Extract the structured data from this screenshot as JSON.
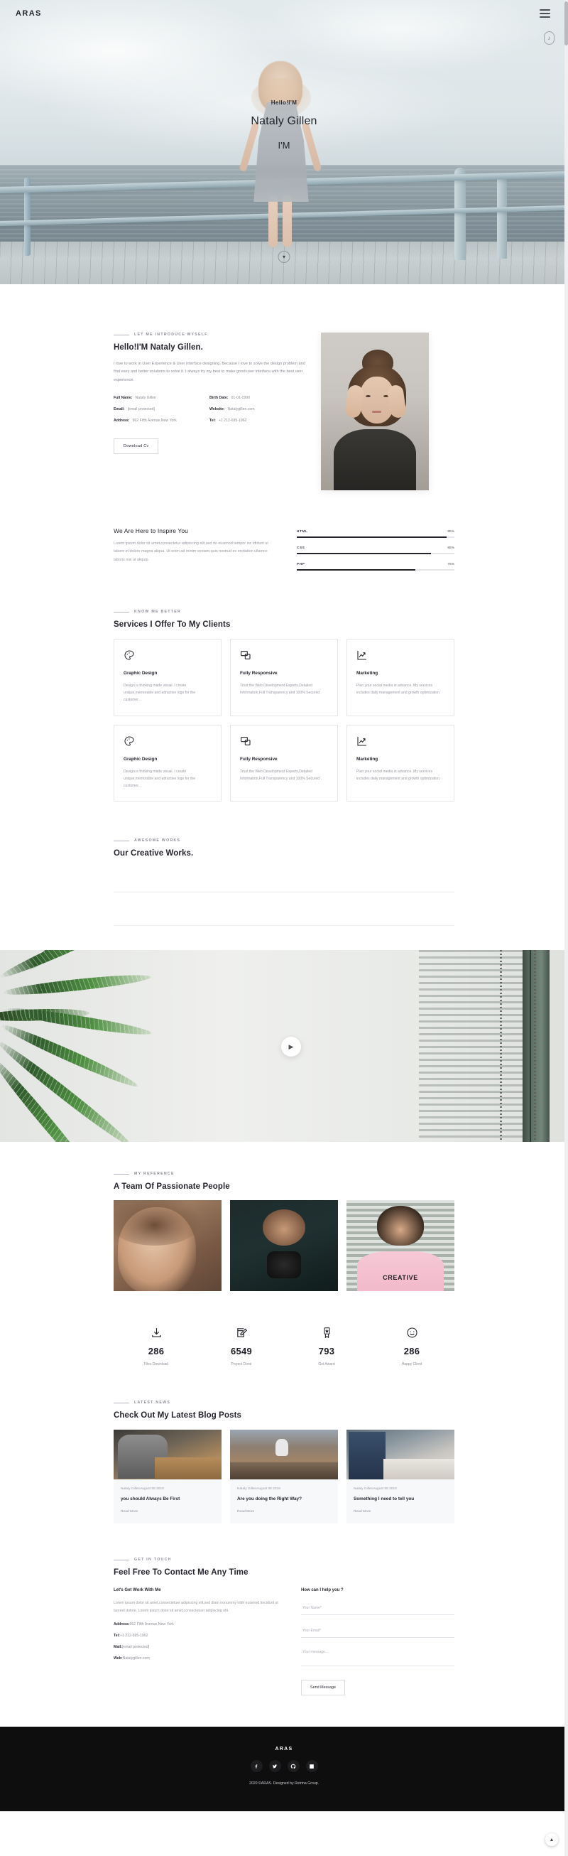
{
  "header": {
    "brand": "ARAS",
    "menu_icon": "hamburger-icon",
    "sound_icon": "sound-toggle-icon"
  },
  "hero": {
    "greeting": "Hello!I'M",
    "name": "Nataly Gillen",
    "role": "I'M",
    "scroll_icon": "chevron-down-icon"
  },
  "about": {
    "eyebrow": "LET ME INTRODUCE MYSELF.",
    "title": "Hello!I'M Nataly Gillen.",
    "paragraph": "I love to work in User Experience & User Interface designing. Because I love to solve the design problem and find easy and better solutions to solve it. I always try my best to make good user interface with the best user experience.",
    "info": [
      {
        "key": "Full Name:",
        "value": "Nataly Gillen"
      },
      {
        "key": "Birth Date:",
        "value": "01-01-1990"
      },
      {
        "key": "Email:",
        "value": "[email protected]"
      },
      {
        "key": "Website:",
        "value": "Natalygillen.com"
      },
      {
        "key": "Address:",
        "value": "962 Fifth Avenue,New York"
      },
      {
        "key": "Tel:",
        "value": "+1 212-695-1962"
      }
    ],
    "cta": "Download Cv"
  },
  "skills": {
    "title": "We Are Here to Inspire You",
    "paragraph": "Lorem ipsum dolor sit amet,consectetur adipiscing elit,sed do eiusmod tempor inc ididunt ut labore et dolore magna aliqua. Ut enim ad minim veniam,quis nostrud ex ercitation ullamco laboris nisi ut aliquip.",
    "bars": [
      {
        "name": "HTML",
        "pct": "95%",
        "value": 95
      },
      {
        "name": "CSS",
        "pct": "85%",
        "value": 85
      },
      {
        "name": "PHP",
        "pct": "75%",
        "value": 75
      }
    ]
  },
  "services": {
    "eyebrow": "KNOW ME BETTER",
    "title": "Services I Offer To My Clients",
    "cards": [
      {
        "icon": "palette-icon",
        "title": "Graphic Design",
        "desc": "Design is thinking made visual. I create unique,memorable and attractive logo for the customer. ."
      },
      {
        "icon": "responsive-icon",
        "title": "Fully Responsive",
        "desc": "Trust the Web Development Experts,Detailed Information,Full Transparency and 100% Secured ."
      },
      {
        "icon": "chart-growth-icon",
        "title": "Marketing",
        "desc": "Plan your social media in advance. My services includes daily management and growth optimization."
      },
      {
        "icon": "palette-icon",
        "title": "Graphic Design",
        "desc": "Design is thinking made visual. I create unique,memorable and attractive logo for the customer. ."
      },
      {
        "icon": "responsive-icon",
        "title": "Fully Responsive",
        "desc": "Trust the Web Development Experts,Detailed Information,Full Transparency and 100% Secured ."
      },
      {
        "icon": "chart-growth-icon",
        "title": "Marketing",
        "desc": "Plan your social media in advance. My services includes daily management and growth optimization."
      }
    ]
  },
  "works": {
    "eyebrow": "AWESOME WORKS",
    "title": "Our Creative Works."
  },
  "parallax": {
    "play_icon": "play-icon"
  },
  "team": {
    "eyebrow": "MY REFERENCE",
    "title": "A Team Of Passionate People",
    "members": [
      {
        "photo": "woman-portrait"
      },
      {
        "photo": "photographer-portrait"
      },
      {
        "photo": "man-creative-tshirt",
        "shirt_text": "CREATIVE"
      }
    ]
  },
  "counters": [
    {
      "icon": "download-icon",
      "num": "286",
      "label": "Files Download"
    },
    {
      "icon": "edit-square-icon",
      "num": "6549",
      "label": "Project Done"
    },
    {
      "icon": "award-ribbon-icon",
      "num": "793",
      "label": "Get Award"
    },
    {
      "icon": "smiley-icon",
      "num": "286",
      "label": "Happy Client"
    }
  ],
  "blog": {
    "eyebrow": "LATEST NEWS",
    "title": "Check Out My Latest Blog Posts",
    "posts": [
      {
        "meta": "Nataly GillenAugust 06 2019",
        "title": "you should Always Be First",
        "more": "Read More"
      },
      {
        "meta": "Nataly GillenAugust 06 2019",
        "title": "Are you doing the Right Way?",
        "more": "Read More"
      },
      {
        "meta": "Nataly GillenAugust 06 2019",
        "title": "Something I need to tell you",
        "more": "Read More"
      }
    ]
  },
  "contact": {
    "eyebrow": "GET IN TOUCH",
    "title": "Feel Free To Contact Me Any Time",
    "left_heading": "Let's Get Work With Me",
    "left_paragraph": "Lorem ipsum dolor sit amet,consectetuer adipiscing elit,sed diam nonummy nibh euismod tincidunt ut laoreet dolore. Lorem ipsum dolor sit amet,consectetuer adipiscing elit.",
    "details": [
      {
        "key": "Address:",
        "value": "962 Fifth Avenue,New York"
      },
      {
        "key": "Tel:",
        "value": "+1 212-695-1962"
      },
      {
        "key": "Mail:",
        "value": "[email protected]"
      },
      {
        "key": "Web:",
        "value": "Natalygillen.com"
      }
    ],
    "form_heading": "How can I help you ?",
    "name_placeholder": "Your Name*",
    "email_placeholder": "Your Email*",
    "message_placeholder": "Your message...",
    "submit": "Send Message"
  },
  "footer": {
    "brand": "ARAS",
    "social": [
      "facebook-icon",
      "twitter-icon",
      "github-icon",
      "linkedin-icon"
    ],
    "copyright": "2020 ©ARAS. Designed by Retrina Group."
  },
  "to_top": {
    "icon": "chevron-up-icon"
  },
  "colors": {
    "dark": "#0e0e0f",
    "text": "#25252e",
    "muted": "#9a9aa3",
    "border": "#e6e6ea"
  }
}
